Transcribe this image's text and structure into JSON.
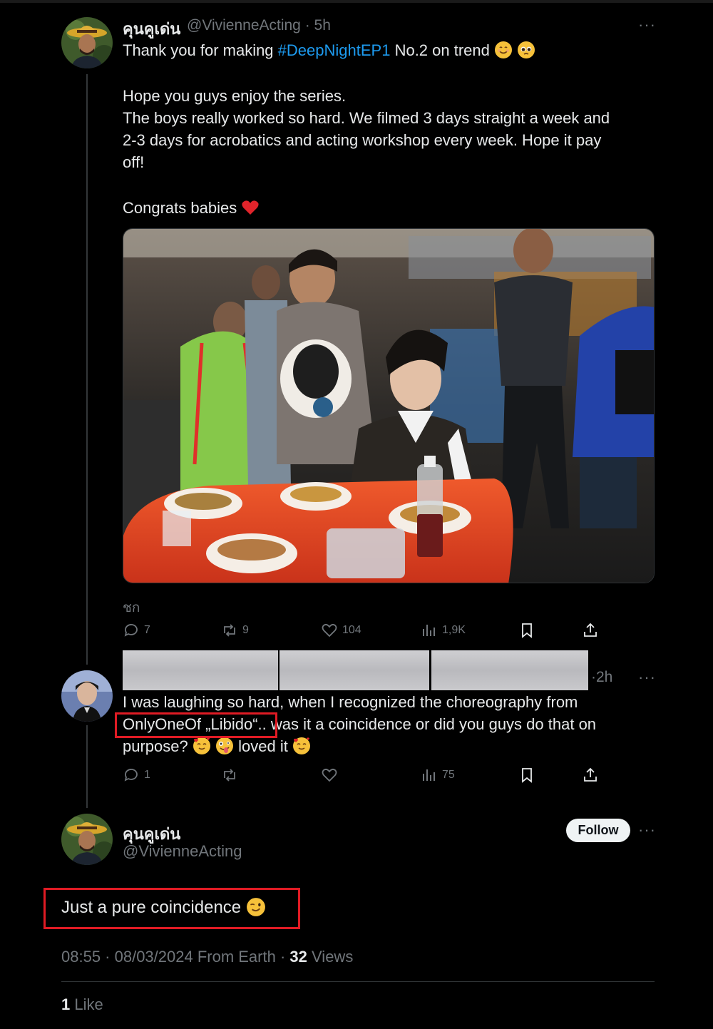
{
  "tweet1": {
    "display_name": "คุนคูเด่น",
    "handle": "@VivienneActing",
    "time": "5h",
    "line1_before": "Thank you for making ",
    "hashtag": "#DeepNightEP1",
    "line1_after": " No.2 on trend",
    "para2_line1": "Hope you guys enjoy the series.",
    "para2_line2": "The boys really worked so hard. We filmed 3 days straight a week and",
    "para2_line3": "2-3 days for acrobatics and acting workshop every week. Hope it pay",
    "para2_line4": "off!",
    "para3": "Congrats babies",
    "media_caption": "ชก",
    "actions": {
      "replies": "7",
      "reposts": "9",
      "likes": "104",
      "views": "1,9K"
    }
  },
  "tweet2": {
    "time": "2h",
    "line1": "I was laughing so hard, when I recognized the choreography from",
    "highlight": "OnlyOneOf „Libido“",
    "line2_after": ".. was it a coincidence or did you guys do that on",
    "line3_before": "purpose?",
    "line3_after": " loved it",
    "actions": {
      "replies": "1",
      "reposts": "",
      "likes": "",
      "views": "75"
    }
  },
  "tweet3": {
    "display_name": "คุนคูเด่น",
    "handle": "@VivienneActing",
    "follow_label": "Follow",
    "text": "Just a pure coincidence",
    "timestamp": "08:55 · 08/03/2024 From Earth",
    "views_count": "32",
    "views_label": "Views",
    "likes_count": "1",
    "likes_label": "Like"
  },
  "colors": {
    "accent": "#1d9bf0",
    "highlight_box": "#e01b24",
    "muted_text": "#71767b",
    "follow_bg": "#eff3f4"
  }
}
